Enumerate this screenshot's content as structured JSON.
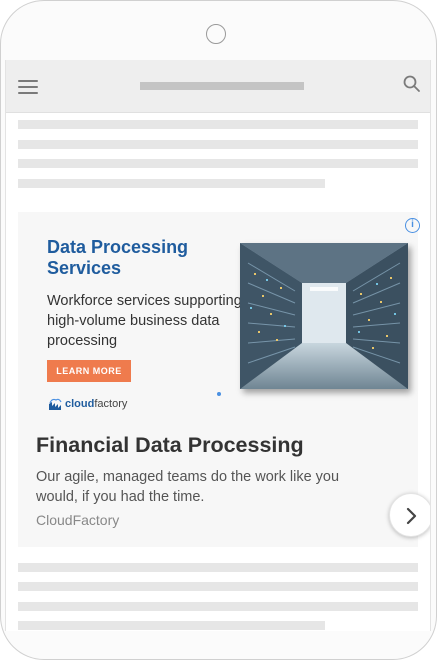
{
  "ad": {
    "creative": {
      "title": "Data Processing Services",
      "body": "Workforce services supporting high-volume business data processing",
      "cta_label": "LEARN MORE",
      "logo_brand_bold": "cloud",
      "logo_brand_rest": "factory"
    },
    "headline": "Financial Data Processing",
    "description": "Our agile, managed teams do the work like you would, if you had the time.",
    "advertiser": "CloudFactory",
    "info_icon_glyph": "i",
    "colors": {
      "title": "#1f5c9e",
      "cta": "#ef7b4d",
      "info": "#4a90e2"
    }
  },
  "icons": {
    "menu": "hamburger-menu-icon",
    "search": "search-icon",
    "info": "info-icon",
    "next": "chevron-right-icon",
    "logo": "cloudfactory-logo-icon"
  }
}
